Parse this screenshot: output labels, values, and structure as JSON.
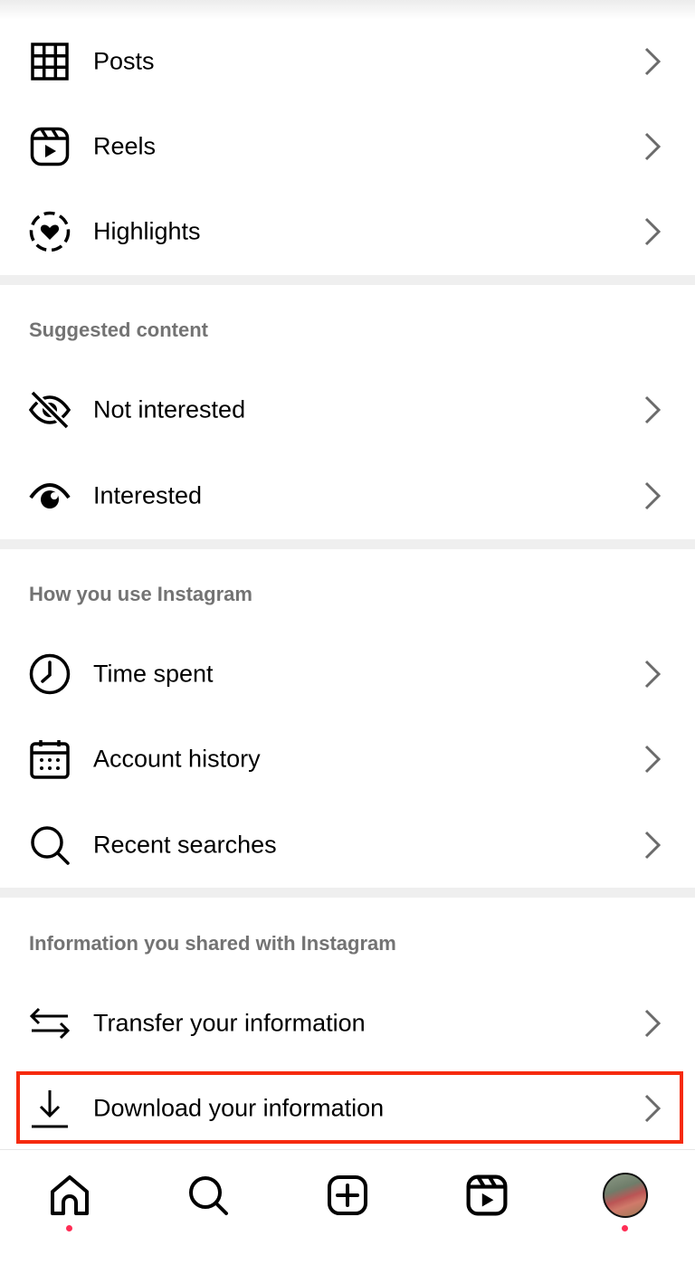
{
  "menu": {
    "items_top": [
      {
        "label": "Posts",
        "icon": "grid-icon"
      },
      {
        "label": "Reels",
        "icon": "reels-icon"
      },
      {
        "label": "Highlights",
        "icon": "highlights-icon"
      }
    ]
  },
  "sections": {
    "suggested": {
      "header": "Suggested content",
      "items": [
        {
          "label": "Not interested",
          "icon": "eye-off-icon"
        },
        {
          "label": "Interested",
          "icon": "eye-icon"
        }
      ]
    },
    "usage": {
      "header": "How you use Instagram",
      "items": [
        {
          "label": "Time spent",
          "icon": "clock-icon"
        },
        {
          "label": "Account history",
          "icon": "calendar-icon"
        },
        {
          "label": "Recent searches",
          "icon": "search-icon"
        }
      ]
    },
    "shared": {
      "header": "Information you shared with Instagram",
      "items": [
        {
          "label": "Transfer your information",
          "icon": "transfer-icon"
        },
        {
          "label": "Download your information",
          "icon": "download-icon"
        }
      ]
    }
  },
  "bottom_nav": {
    "items": [
      "home-icon",
      "search-icon",
      "create-icon",
      "reels-icon",
      "profile-avatar"
    ],
    "notification_color": "#ff2d55"
  },
  "colors": {
    "highlight_border": "#f62a0d",
    "section_header": "#737373",
    "separator": "#efefef"
  }
}
